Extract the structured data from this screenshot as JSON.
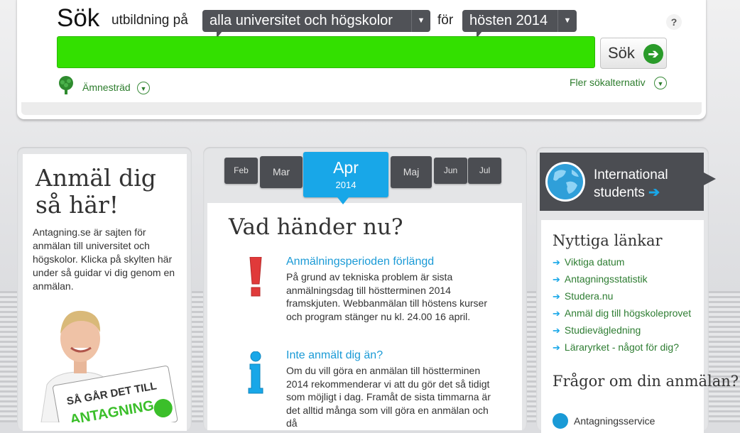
{
  "search": {
    "heading": "Sök",
    "prefix": "utbildning på",
    "universities_dropdown": "alla universitet och högskolor",
    "connector": "för",
    "term_dropdown": "hösten 2014",
    "help_label": "?",
    "input_value": "",
    "button_label": "Sök",
    "subject_tree_label": "Ämnesträd",
    "more_options_label": "Fler sökalternativ"
  },
  "left": {
    "title": "Anmäl dig så här!",
    "text": "Antagning.se är sajten för anmälan till universitet och högskolor. Klicka på skylten här under så guidar vi dig genom en anmälan.",
    "sign_line1": "SÅ GÅR DET TILL",
    "sign_line2": "ANTAGNING"
  },
  "timeline": {
    "months": [
      "Feb",
      "Mar",
      "Apr",
      "Maj",
      "Jun",
      "Jul"
    ],
    "active_month": "Apr",
    "active_year": "2014"
  },
  "news": {
    "heading": "Vad händer nu?",
    "items": [
      {
        "title": "Anmälningsperioden förlängd",
        "body": "På grund av tekniska problem är sista anmälningsdag till höstterminen 2014 framskjuten. Webbanmälan till höstens kurser och program stänger nu kl. 24.00 16 april."
      },
      {
        "title": "Inte anmält dig än?",
        "body": "Om du vill göra en anmälan till höstterminen 2014 rekommenderar vi att du gör det så tidigt som möjligt i dag. Framåt de sista timmarna är det alltid många som vill göra en anmälan och då"
      }
    ]
  },
  "right": {
    "international_line1": "International",
    "international_line2": "students",
    "useful_links_heading": "Nyttiga länkar",
    "links": [
      "Viktiga datum",
      "Antagningsstatistik",
      "Studera.nu",
      "Anmäl dig till högskoleprovet",
      "Studievägledning",
      "Läraryrket - något för dig?"
    ],
    "questions_heading": "Frågor om din anmälan?",
    "service_label": "Antagningsservice"
  },
  "colors": {
    "search_green": "#33e000",
    "accent_blue": "#18a7e8",
    "link_green": "#2e7d32",
    "dark_tab": "#4b4d52"
  }
}
